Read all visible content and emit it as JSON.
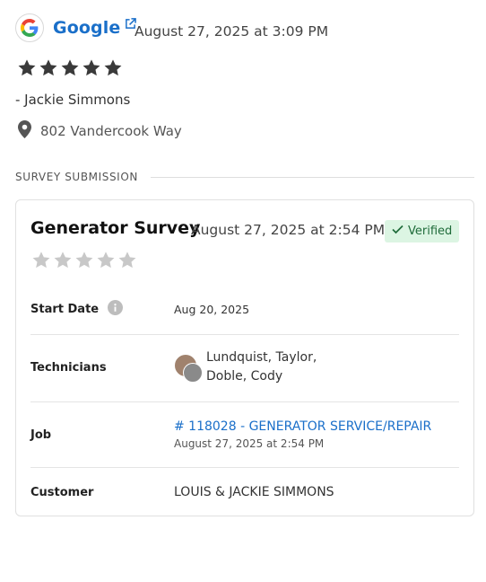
{
  "review": {
    "source": "Google",
    "date": "August 27, 2025 at 3:09 PM",
    "rating": 5,
    "reviewer": "- Jackie Simmons",
    "address": "802 Vandercook Way"
  },
  "section": {
    "label": "SURVEY SUBMISSION"
  },
  "survey": {
    "title": "Generator Survey",
    "date": "August 27, 2025 at 2:54 PM",
    "badge": "Verified",
    "rating": 0,
    "start_date_label": "Start Date",
    "start_date_value": "Aug 20, 2025",
    "technicians_label": "Technicians",
    "technicians_line1": "Lundquist, Taylor,",
    "technicians_line2": "Doble, Cody",
    "job_label": "Job",
    "job_link": "# 118028 - GENERATOR SERVICE/REPAIR",
    "job_date": "August 27, 2025 at 2:54 PM",
    "customer_label": "Customer",
    "customer_value": "LOUIS & JACKIE SIMMONS"
  },
  "colors": {
    "link": "#1a6fc9",
    "star_filled": "#3a3a3a",
    "star_empty": "#c8c8c8",
    "verified_bg": "#dcf5e3",
    "verified_text": "#1f6b3a"
  }
}
